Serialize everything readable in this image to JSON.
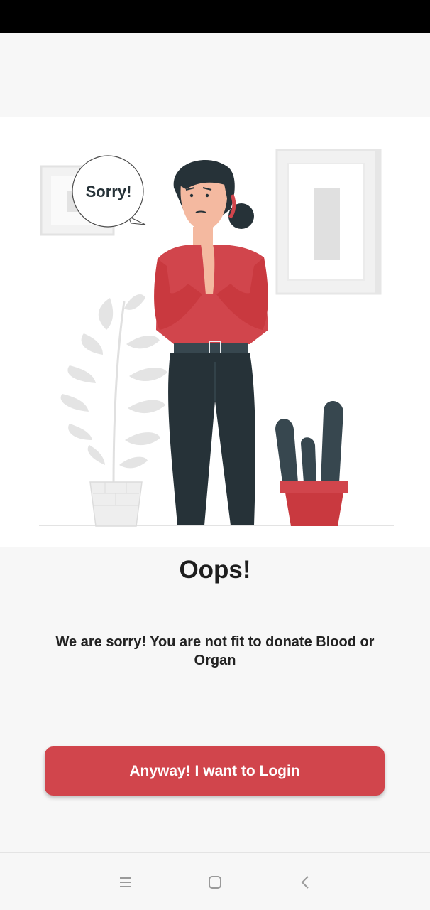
{
  "illustration": {
    "speech_bubble_text": "Sorry!",
    "accent_color": "#d1454c",
    "dark_color": "#263238"
  },
  "main": {
    "title": "Oops!",
    "message": "We are sorry! You are not fit to donate Blood or Organ",
    "login_button_label": "Anyway! I want to Login"
  },
  "navbar": {
    "icons": [
      "menu-icon",
      "home-square-icon",
      "back-chevron-icon"
    ]
  }
}
